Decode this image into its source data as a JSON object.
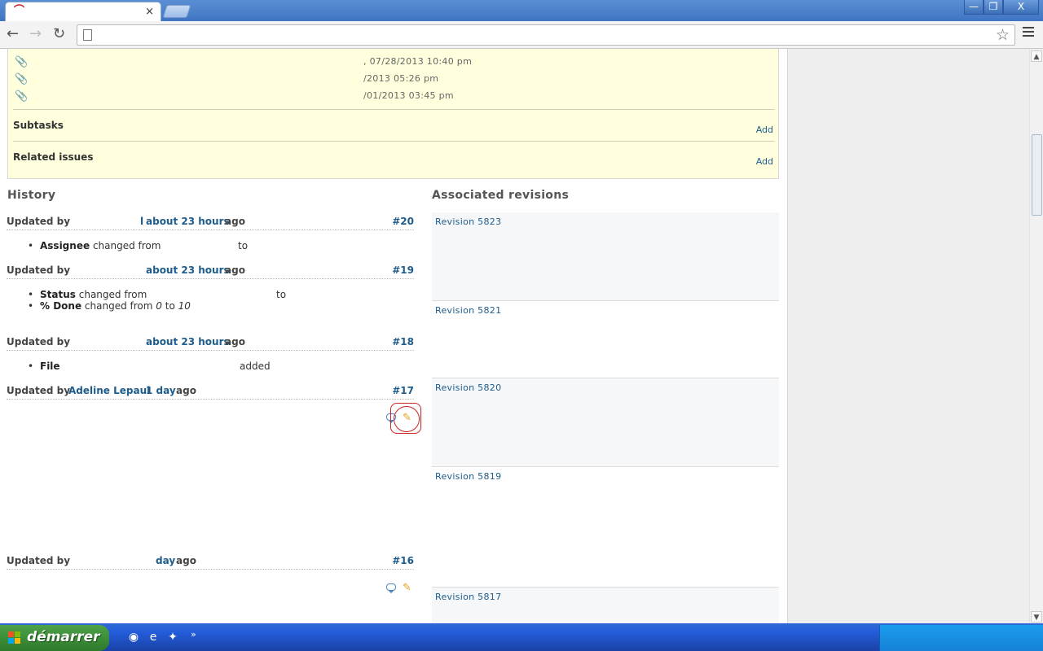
{
  "browser": {
    "tab_close": "×",
    "window_min": "—",
    "window_max": "❐",
    "window_close": "X",
    "back": "←",
    "forward": "→",
    "reload": "↻",
    "url": "",
    "star": "☆"
  },
  "attachments": {
    "rows": [
      {
        "date": ", 07/28/2013 10:40 pm"
      },
      {
        "date": "/2013 05:26 pm"
      },
      {
        "date": "/01/2013 03:45 pm"
      }
    ]
  },
  "subtasks": {
    "title": "Subtasks",
    "add": "Add"
  },
  "related": {
    "title": "Related issues",
    "add": "Add"
  },
  "history": {
    "title": "History",
    "journals": [
      {
        "by": "Updated by",
        "author": "l",
        "when": "about 23 hours",
        "ago": "ago",
        "num": "#20",
        "details": [
          {
            "field": "Assignee",
            "text": "changed from",
            "to": "to"
          }
        ]
      },
      {
        "by": "Updated by",
        "author": "",
        "when": "about 23 hours",
        "ago": "ago",
        "num": "#19",
        "details": [
          {
            "field": "Status",
            "text": "changed from",
            "to": "to"
          },
          {
            "field": "% Done",
            "text": "changed from",
            "old": "0",
            "new": "10"
          }
        ]
      },
      {
        "by": "Updated by",
        "author": "",
        "when": "about 23 hours",
        "ago": "ago",
        "num": "#18",
        "details": [
          {
            "field": "File",
            "text": "added"
          }
        ]
      },
      {
        "by": "Updated by",
        "author": "Adeline Lepaul",
        "when": "1 day",
        "ago": "ago",
        "num": "#17"
      },
      {
        "by": "Updated by",
        "author": "",
        "when": "day",
        "ago": "ago",
        "num": "#16"
      }
    ]
  },
  "revisions": {
    "title": "Associated revisions",
    "items": [
      {
        "label": "Revision 5823"
      },
      {
        "label": "Revision 5821"
      },
      {
        "label": "Revision 5820"
      },
      {
        "label": "Revision 5819"
      },
      {
        "label": "Revision 5817"
      }
    ]
  },
  "taskbar": {
    "start_label": "démarrer",
    "more": "»"
  }
}
